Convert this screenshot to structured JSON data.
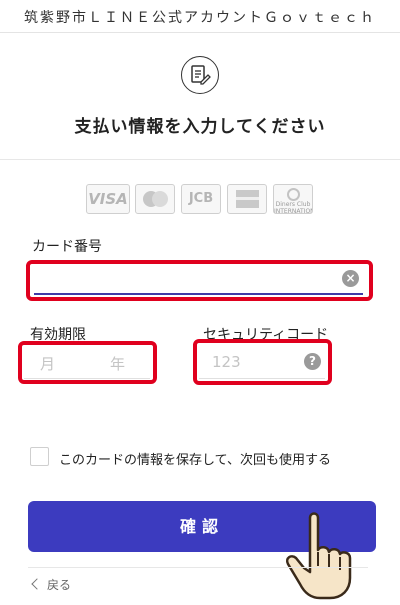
{
  "header": {
    "title": "筑紫野市ＬＩＮＥ公式アカウントＧｏｖｔｅｃｈ"
  },
  "form": {
    "icon": "form-edit-icon",
    "heading": "支払い情報を入力してください"
  },
  "card_brands": [
    {
      "name": "visa-logo",
      "text": "VISA"
    },
    {
      "name": "mastercard-logo",
      "text": ""
    },
    {
      "name": "jcb-logo",
      "text": "JCB"
    },
    {
      "name": "amex-logo",
      "text": ""
    },
    {
      "name": "diners-logo",
      "text": "Diners Club INTERNATIONAL"
    }
  ],
  "card_number": {
    "label": "カード番号",
    "value": "",
    "placeholder": ""
  },
  "expiry": {
    "label": "有効期限",
    "month_placeholder": "月",
    "year_placeholder": "年"
  },
  "security_code": {
    "label": "セキュリティコード",
    "placeholder": "123",
    "help_icon": "?"
  },
  "save_card": {
    "label": "このカードの情報を保存して、次回も使用する",
    "checked": false
  },
  "confirm_button": {
    "label": "確認"
  },
  "back_link": {
    "label": "戻る"
  },
  "colors": {
    "primary": "#3c3bbf",
    "highlight": "#e0001e",
    "input_underline": "#3f3aa8"
  }
}
